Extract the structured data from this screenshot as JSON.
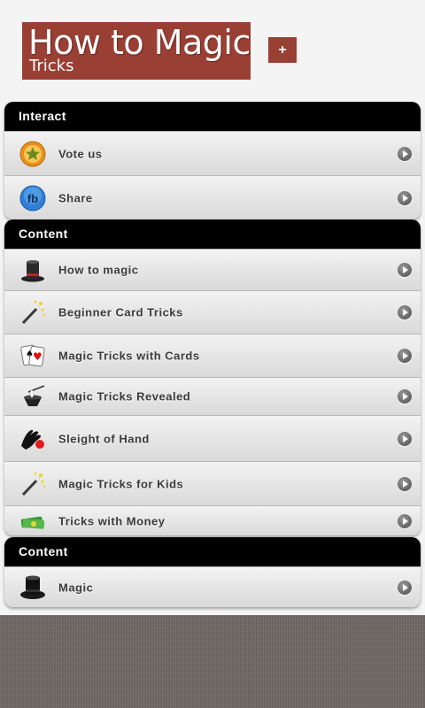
{
  "header": {
    "title_main": "How to Magic",
    "title_sub": "Tricks",
    "plus_label": "+"
  },
  "sections": [
    {
      "title": "Interact",
      "items": [
        {
          "label": "Vote us",
          "icon": "star-medal-icon"
        },
        {
          "label": "Share",
          "icon": "facebook-icon"
        }
      ]
    },
    {
      "title": "Content",
      "items": [
        {
          "label": "How to magic",
          "icon": "top-hat-icon"
        },
        {
          "label": "Beginner Card Tricks",
          "icon": "magic-wand-icon"
        },
        {
          "label": "Magic Tricks with Cards",
          "icon": "playing-cards-icon"
        },
        {
          "label": "Magic Tricks Revealed",
          "icon": "hat-and-wand-icon"
        },
        {
          "label": "Sleight of Hand",
          "icon": "hand-with-ball-icon"
        },
        {
          "label": "Magic Tricks for Kids",
          "icon": "magic-wand-icon"
        },
        {
          "label": "Tricks with Money",
          "icon": "money-icon"
        }
      ]
    },
    {
      "title": "Content",
      "items": [
        {
          "label": "Magic",
          "icon": "top-hat-icon"
        }
      ]
    }
  ],
  "colors": {
    "title_bg": "#9a3f33",
    "section_header_bg": "#000000",
    "footer_bg": "#6f6864"
  }
}
